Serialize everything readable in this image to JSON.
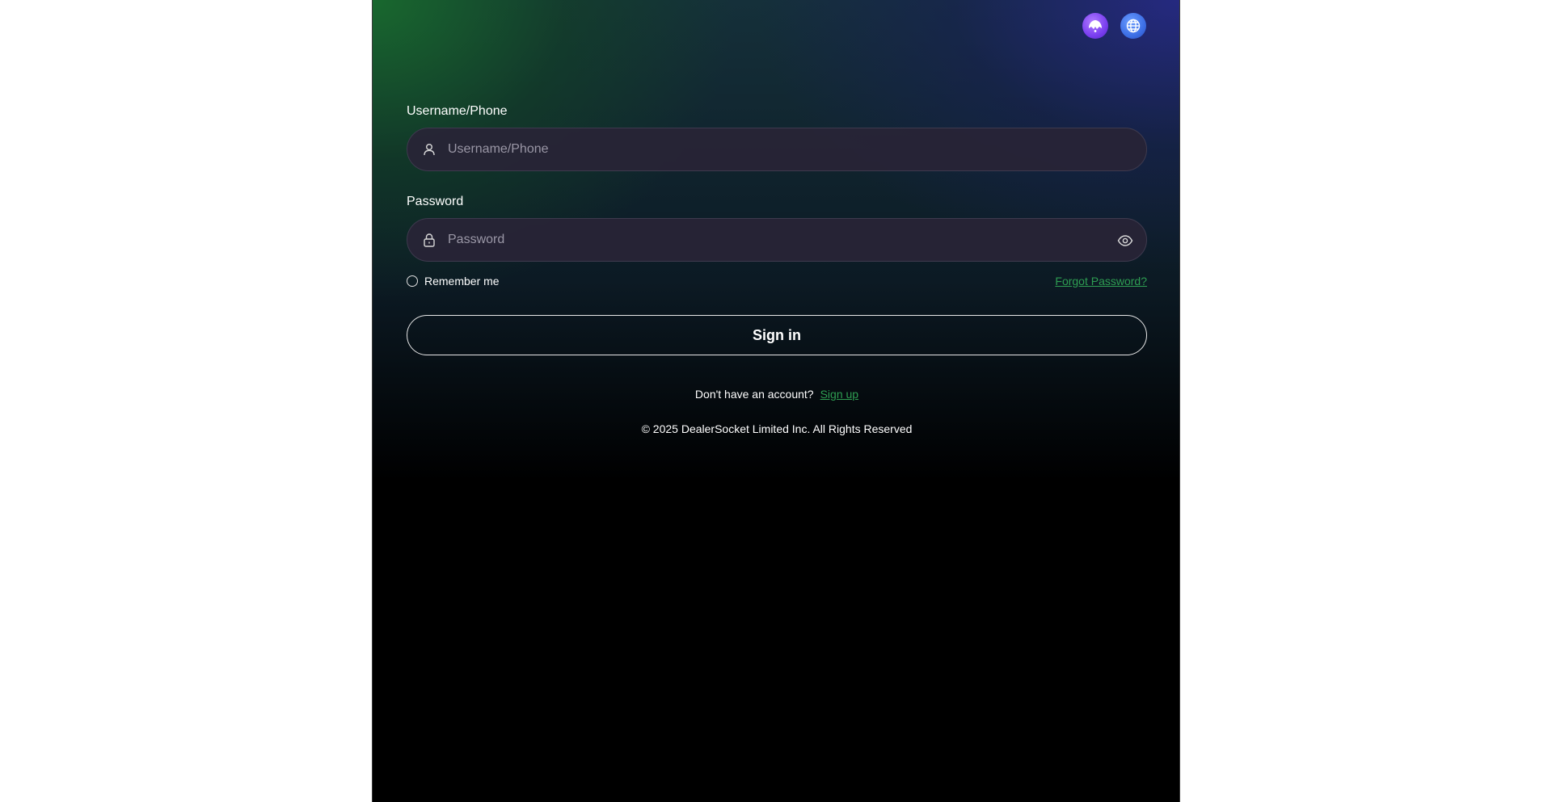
{
  "header": {
    "icons": [
      {
        "name": "brand-logo-icon",
        "color": "#7a3ff0"
      },
      {
        "name": "globe-icon",
        "color": "#3d6fe6"
      }
    ]
  },
  "form": {
    "username": {
      "label": "Username/Phone",
      "placeholder": "Username/Phone",
      "value": "",
      "icon": "user-icon"
    },
    "password": {
      "label": "Password",
      "placeholder": "Password",
      "value": "",
      "icon": "lock-icon",
      "toggle_icon": "eye-icon"
    },
    "remember_label": "Remember me",
    "remember_checked": false,
    "forgot_label": "Forgot Password?",
    "submit_label": "Sign in"
  },
  "footer": {
    "signup_prompt": "Don't have an account?",
    "signup_link": "Sign up",
    "copyright": "© 2025 DealerSocket Limited Inc. All Rights Reserved"
  },
  "colors": {
    "accent_green": "#2e9e52",
    "panel_bg": "#000000",
    "input_bg": "#28243a"
  }
}
